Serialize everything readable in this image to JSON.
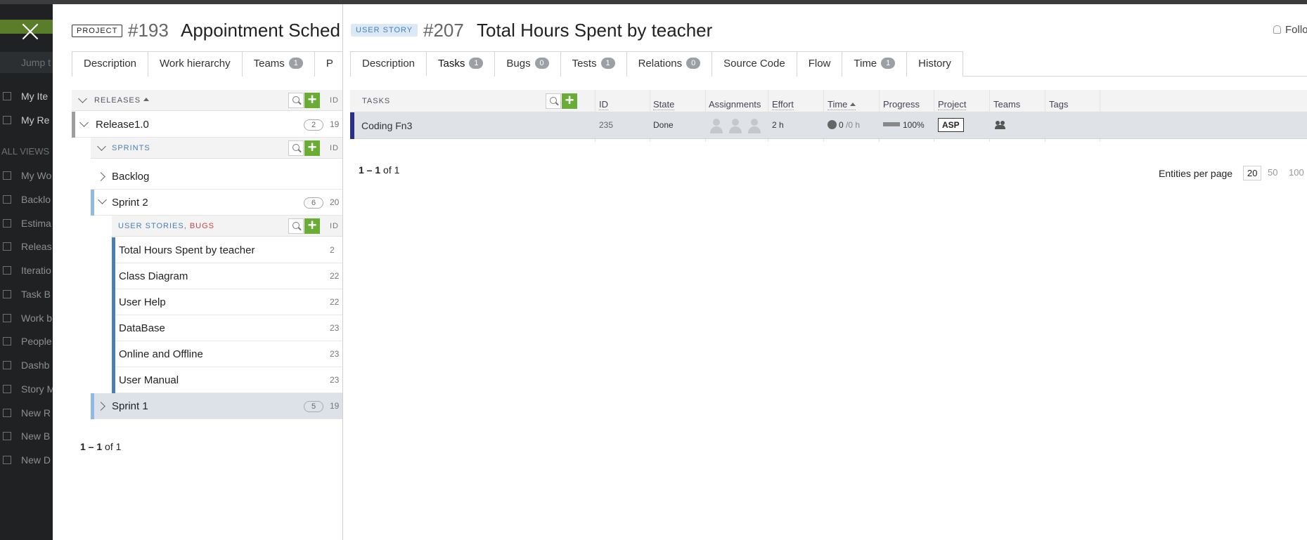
{
  "sidebar": {
    "jump_placeholder": "Jump t",
    "items": [
      {
        "label": "My Ite"
      },
      {
        "label": "My Re"
      },
      {
        "label": "My Wo"
      },
      {
        "label": "Backlo"
      },
      {
        "label": "Estima"
      },
      {
        "label": "Releas"
      },
      {
        "label": "Iteratio"
      },
      {
        "label": "Task B"
      },
      {
        "label": "Work b"
      },
      {
        "label": "People"
      },
      {
        "label": "Dashb"
      },
      {
        "label": "Story M"
      },
      {
        "label": "New R"
      },
      {
        "label": "New B"
      },
      {
        "label": "New D"
      }
    ],
    "section_label": "ALL VIEWS"
  },
  "project": {
    "type_badge": "PROJECT",
    "id": "#193",
    "title": "Appointment Sched",
    "tabs": [
      {
        "label": "Description"
      },
      {
        "label": "Work hierarchy"
      },
      {
        "label": "Teams",
        "count": "1"
      },
      {
        "label": "P"
      }
    ],
    "releases_header": "RELEASES",
    "id_header": "ID",
    "release": {
      "name": "Release1.0",
      "count": "2",
      "id": "19"
    },
    "sprints_header": "SPRINTS",
    "backlog_label": "Backlog",
    "sprint2": {
      "name": "Sprint 2",
      "count": "6",
      "id": "20"
    },
    "stories_header_a": "USER STORIES",
    "stories_header_sep": ",",
    "stories_header_b": "BUGS",
    "stories": [
      {
        "name": "Total Hours Spent by teacher",
        "id": "2"
      },
      {
        "name": "Class Diagram",
        "id": "22"
      },
      {
        "name": "User Help",
        "id": "22"
      },
      {
        "name": "DataBase",
        "id": "23"
      },
      {
        "name": "Online and Offline",
        "id": "23"
      },
      {
        "name": "User Manual",
        "id": "23"
      }
    ],
    "sprint1": {
      "name": "Sprint 1",
      "count": "5",
      "id": "19"
    },
    "pager_range": "1 – 1",
    "pager_of": " of 1"
  },
  "story": {
    "type_badge": "USER STORY",
    "id": "#207",
    "title": "Total Hours Spent by teacher",
    "follow_label": "Follo",
    "tabs": [
      {
        "label": "Description"
      },
      {
        "label": "Tasks",
        "count": "1"
      },
      {
        "label": "Bugs",
        "count": "0"
      },
      {
        "label": "Tests",
        "count": "1"
      },
      {
        "label": "Relations",
        "count": "0"
      },
      {
        "label": "Source Code"
      },
      {
        "label": "Flow"
      },
      {
        "label": "Time",
        "count": "1"
      },
      {
        "label": "History"
      }
    ],
    "tasks_header": "TASKS",
    "columns": [
      "ID",
      "State",
      "Assignments",
      "Effort",
      "Time",
      "Progress",
      "Project",
      "Teams",
      "Tags"
    ],
    "task": {
      "name": "Coding Fn3",
      "id": "235",
      "state": "Done",
      "effort": "2 h",
      "time_spent": "0",
      "time_remaining": "/0 h",
      "progress": "100%",
      "project": "ASP"
    },
    "pager_range": "1 – 1",
    "pager_of": " of 1",
    "entities_per_page_label": "Entities per page",
    "page_sizes": [
      "20",
      "50",
      "100"
    ]
  }
}
